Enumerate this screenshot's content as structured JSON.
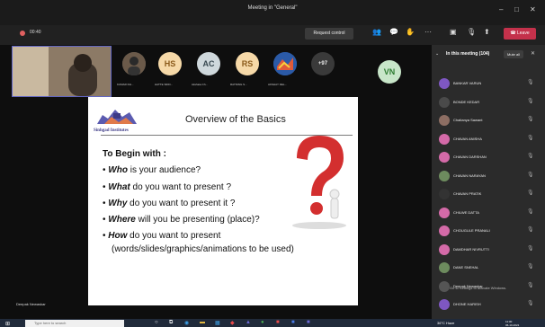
{
  "window": {
    "title": "Meeting in \"General\""
  },
  "toolbar": {
    "timer": "00:40",
    "request_control": "Request control",
    "leave": "Leave"
  },
  "participants_strip": [
    {
      "initials": "",
      "label": "KUMAR DH..."
    },
    {
      "initials": "HS",
      "label": "HATTE SIDD..."
    },
    {
      "initials": "AC",
      "label": "Akshata Ch..."
    },
    {
      "initials": "RS",
      "label": "RATNING S..."
    },
    {
      "initials": "",
      "label": "AKSHAY DEL..."
    },
    {
      "initials": "+97",
      "label": ""
    },
    {
      "initials": "VN",
      "label": ""
    }
  ],
  "slide": {
    "logo_text": "Sinhgad Institutes",
    "title": "Overview of the Basics",
    "subheading": "To Begin with :",
    "bullets": [
      {
        "bold": "Who",
        "rest": " is your audience?"
      },
      {
        "bold": "What",
        "rest": " do you want to present ?"
      },
      {
        "bold": "Why",
        "rest": " do you want to present it ?"
      },
      {
        "bold": "Where",
        "rest": " will you be presenting (place)?"
      },
      {
        "bold": "How",
        "rest": "      do      you      want      to      present"
      },
      {
        "bold": "",
        "rest": "(words/slides/graphics/animations to be used)"
      }
    ]
  },
  "speaker_name": "Deepak Newaskar",
  "panel": {
    "title": "In this meeting (104)",
    "mute_all": "Mute all",
    "people": [
      {
        "name": "BANKAR VARUN",
        "color": "#7e57c2"
      },
      {
        "name": "BONDE KEDAR",
        "color": "#4a4a4a"
      },
      {
        "name": "Chaitanya Sawant",
        "color": "#8d6e63"
      },
      {
        "name": "CHAVAN ANISHA",
        "color": "#d46aa8"
      },
      {
        "name": "CHAVAN DARSHAN",
        "color": "#d46aa8"
      },
      {
        "name": "CHAVAN NARAYAN",
        "color": "#6d8b5e"
      },
      {
        "name": "CHAVAN PRATIK",
        "color": "#333333"
      },
      {
        "name": "CHILWE DATTA",
        "color": "#d46aa8"
      },
      {
        "name": "CHOUGULE PRANALI",
        "color": "#d46aa8"
      },
      {
        "name": "DAMDHAR NIVRUTTI",
        "color": "#d46aa8"
      },
      {
        "name": "DANE SNEHAL",
        "color": "#6d8b5e"
      },
      {
        "name": "Deepak Newaskar",
        "color": "#555555"
      },
      {
        "name": "DHONE HARISH",
        "color": "#7e57c2"
      }
    ],
    "watermark": "Go to Settings to activate Windows."
  },
  "taskbar": {
    "search_placeholder": "Type here to search",
    "weather": "36°C Haze",
    "clock_time": "11:00",
    "clock_date": "06-10-2021"
  }
}
